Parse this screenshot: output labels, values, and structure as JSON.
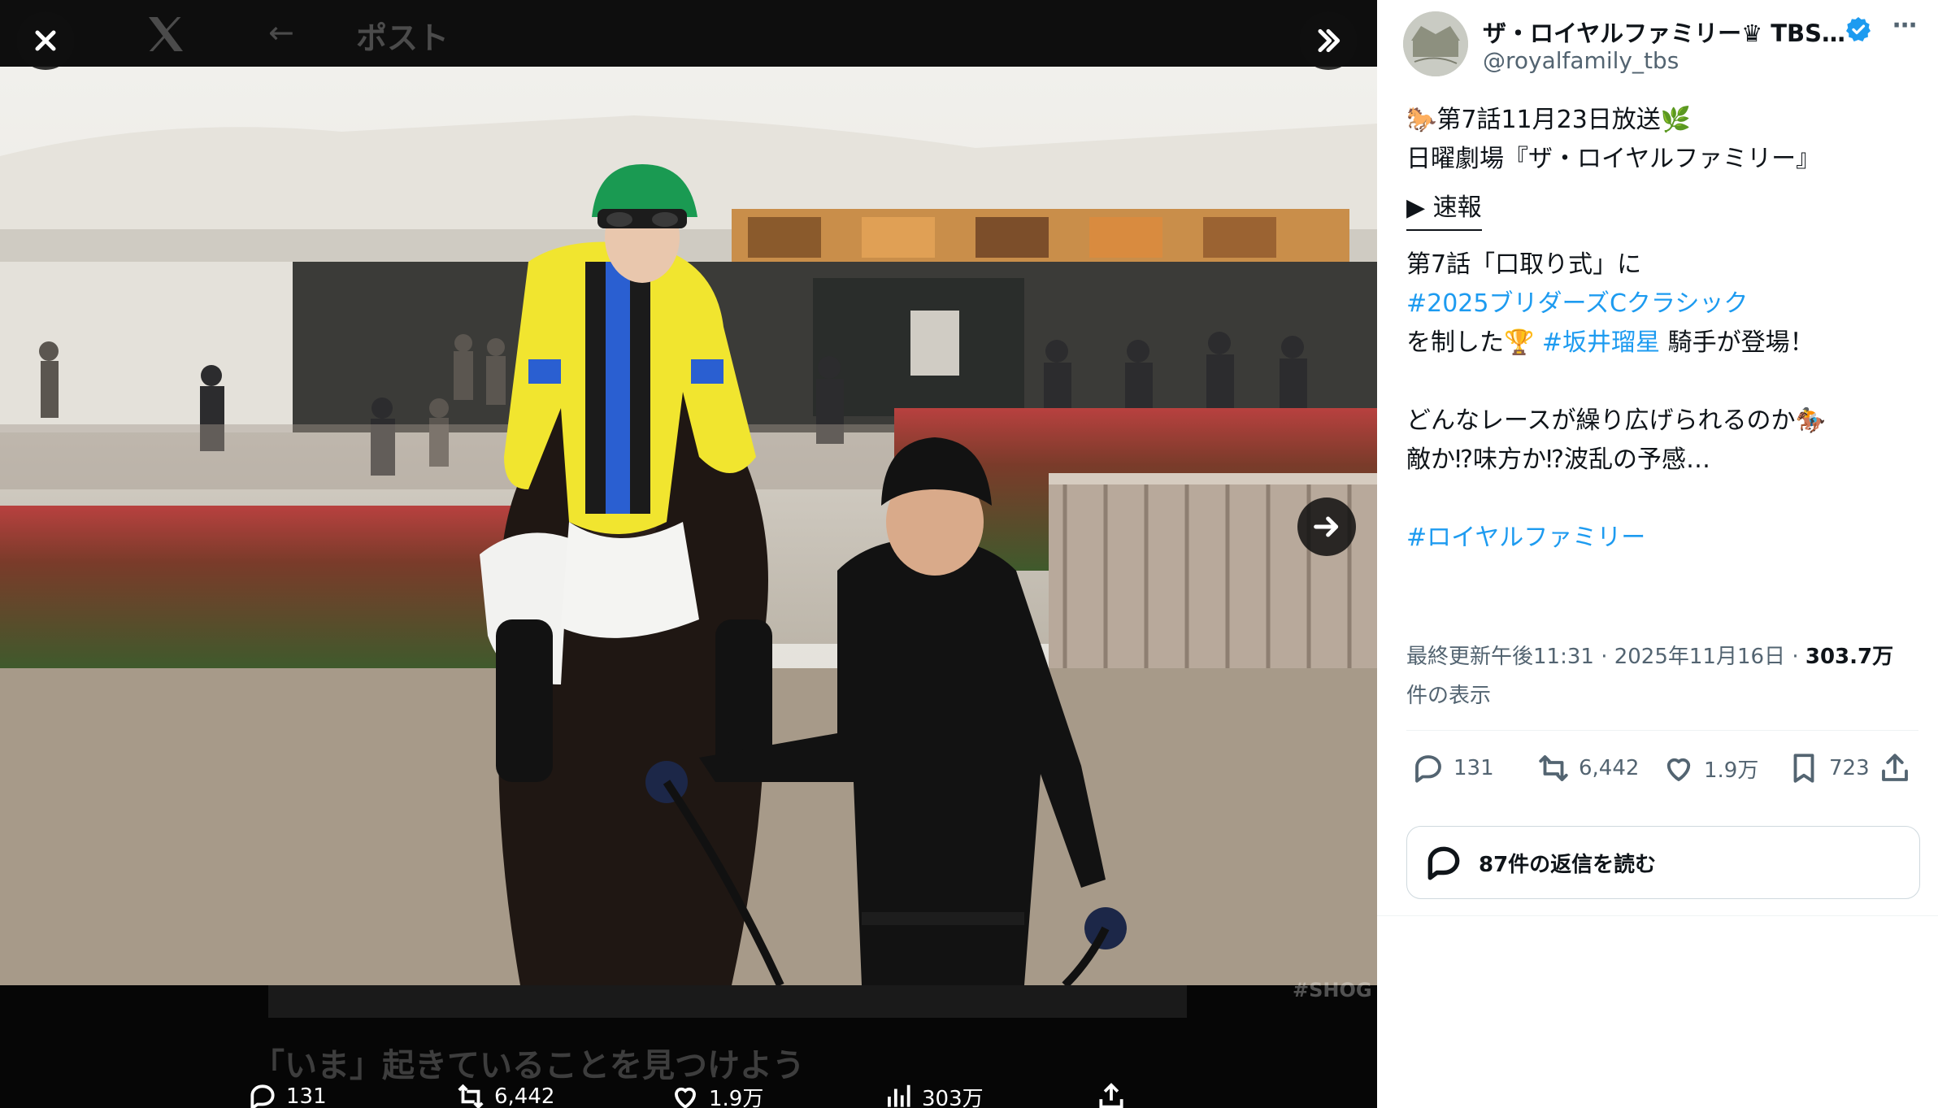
{
  "viewer": {
    "background_header_title": "ポスト",
    "background_overlay_text": "「いま」起きていることを見つけよう",
    "background_hashtag": "#SHOG",
    "background_stats": {
      "replies": "131",
      "reposts": "6,442",
      "likes": "1.9万",
      "views": "303万"
    }
  },
  "tweet": {
    "author_name": "ザ・ロイヤルファミリー♛ TBS1...",
    "handle": "@royalfamily_tbs",
    "text": {
      "line1_emoji_start": "🐎",
      "line1": "第7話11月23日放送",
      "line1_emoji_end": "🌿",
      "line2": "日曜劇場『ザ・ロイヤルファミリー』",
      "line3": "▶︎ 速報",
      "line4": "第7話「口取り式」に",
      "line5_hashtag": "#2025ブリダーズCクラシック",
      "line6_prefix": "を制した",
      "line6_emoji": "🏆",
      "line6_hashtag": "#坂井瑠星",
      "line6_suffix": " 騎手が登場！",
      "line7": "どんなレースが繰り広げられるのか",
      "line7_emoji": "🏇",
      "line8": "敵か⁉味方か⁉波乱の予感…",
      "line9_hashtag": "#ロイヤルファミリー"
    },
    "meta": {
      "updated_time": "最終更新午後11:31 · 2025年11月16日 · ",
      "views": "303.7万",
      "views_suffix": "件の表示"
    },
    "actions": {
      "replies": "131",
      "reposts": "6,442",
      "likes": "1.9万",
      "bookmarks": "723"
    },
    "read_replies_label": "87件の返信を読む"
  },
  "colors": {
    "accent": "#1d9bf0",
    "text": "#0f1419",
    "secondary": "#536471",
    "border": "#cfd9de"
  },
  "icons": [
    "close-icon",
    "x-logo-icon",
    "back-arrow-icon",
    "collapse-panel-icon",
    "next-arrow-icon",
    "verified-badge-icon",
    "more-icon",
    "reply-icon",
    "repost-icon",
    "like-icon",
    "bookmark-icon",
    "share-icon",
    "views-icon"
  ]
}
